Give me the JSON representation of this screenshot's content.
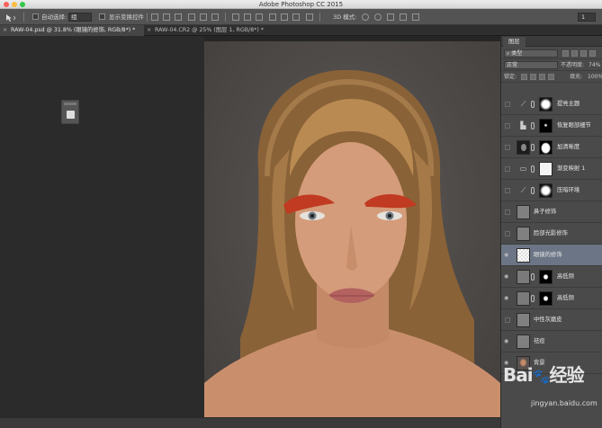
{
  "app": {
    "title": "Adobe Photoshop CC 2015"
  },
  "options_bar": {
    "auto_select_label": "自动选择:",
    "auto_select_value": "组",
    "show_transform_label": "显示变换控件",
    "mode_label": "3D 模式:",
    "right_value": "1"
  },
  "tabs": [
    {
      "label": "RAW-04.psd @ 31.8% (眼镜的修饰, RGB/8*) *"
    },
    {
      "label": "RAW-04.CR2 @ 25% (图层 1, RGB/8*) *"
    }
  ],
  "layers_panel": {
    "tab_label": "图层",
    "filter_type": "类型",
    "blend_mode": "正常",
    "opacity_label": "不透明度:",
    "opacity_value": "74%",
    "lock_label": "锁定:",
    "fill_label": "填充:",
    "fill_value": "100%",
    "layers": [
      {
        "name": "提亮主题",
        "visible": false,
        "kind": "adjust",
        "icon": "curves-icon",
        "mask": "white-blob"
      },
      {
        "name": "恢复眼部细节",
        "visible": false,
        "kind": "adjust",
        "icon": "levels-icon",
        "mask": "black-dot"
      },
      {
        "name": "加清晰度",
        "visible": false,
        "kind": "smart",
        "icon": "face",
        "mask": "white-oval"
      },
      {
        "name": "渐变映射 1",
        "visible": false,
        "kind": "adjust",
        "icon": "gradient-map-icon",
        "mask": "white"
      },
      {
        "name": "压暗环境",
        "visible": false,
        "kind": "adjust",
        "icon": "curves-icon",
        "mask": "white-blob"
      },
      {
        "name": "鼻子修饰",
        "visible": false,
        "kind": "plain",
        "icon": "",
        "mask": ""
      },
      {
        "name": "脸部光影修饰",
        "visible": false,
        "kind": "plain",
        "icon": "",
        "mask": ""
      },
      {
        "name": "眼镜的修饰",
        "visible": true,
        "kind": "plain",
        "icon": "",
        "mask": "",
        "selected": true
      },
      {
        "name": "高低频",
        "visible": true,
        "kind": "smart",
        "icon": "",
        "mask": "black-face"
      },
      {
        "name": "高低频",
        "visible": true,
        "kind": "smart",
        "icon": "",
        "mask": "black-face"
      },
      {
        "name": "中性灰磨皮",
        "visible": false,
        "kind": "plain",
        "icon": "",
        "mask": ""
      },
      {
        "name": "祛痘",
        "visible": true,
        "kind": "plain",
        "icon": "",
        "mask": ""
      },
      {
        "name": "背景",
        "visible": true,
        "kind": "photo",
        "icon": "",
        "mask": ""
      }
    ]
  },
  "watermark": {
    "brand": "Bai",
    "brand_tail": "经验",
    "url": "jingyan.baidu.com"
  },
  "colors": {
    "selected_layer": "#6b7585",
    "panel_bg": "#4a4a4a",
    "workspace_bg": "#262626"
  }
}
